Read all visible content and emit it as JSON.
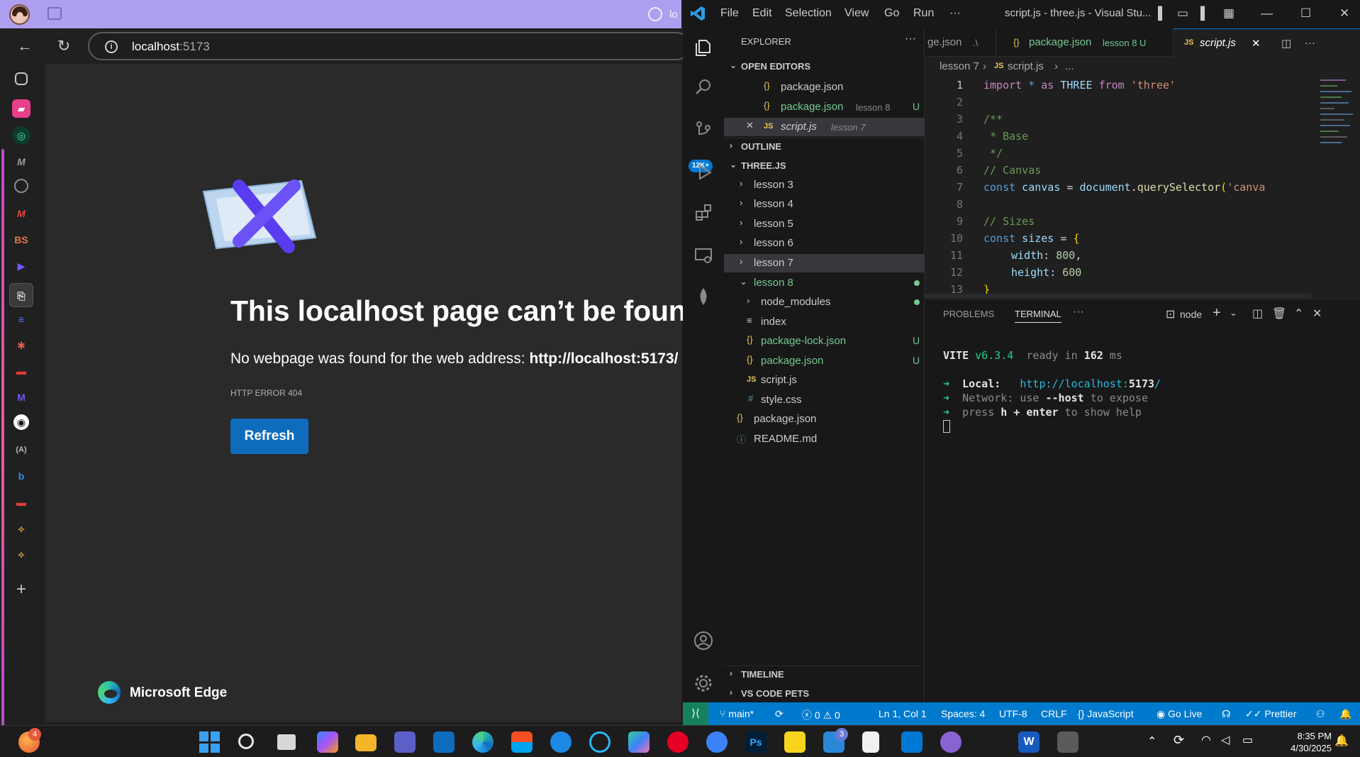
{
  "edge": {
    "tab_fragment": "lo",
    "address": {
      "host": "localhost",
      "port": ":5173"
    },
    "error": {
      "title": "This localhost page can’t be found",
      "subtitle_prefix": "No webpage was found for the web address: ",
      "subtitle_url": "http://localhost:5173/",
      "code": "HTTP ERROR 404",
      "refresh_label": "Refresh"
    },
    "brand": "Microsoft Edge"
  },
  "vscode": {
    "menus": [
      "File",
      "Edit",
      "Selection",
      "View",
      "Go",
      "Run",
      "···"
    ],
    "window_title": "script.js - three.js - Visual Stu...",
    "activity_badge": "12K+",
    "explorer": {
      "header": "EXPLORER",
      "open_editors": "OPEN EDITORS",
      "outline": "OUTLINE",
      "project": "THREE.JS",
      "timeline": "TIMELINE",
      "pets": "VS CODE PETS",
      "open_files": [
        {
          "name": "package.json",
          "desc": "",
          "status": ""
        },
        {
          "name": "package.json",
          "desc": "lesson 8",
          "status": "U"
        },
        {
          "name": "script.js",
          "desc": "lesson 7",
          "status": ""
        }
      ],
      "tree": [
        {
          "name": "lesson 3"
        },
        {
          "name": "lesson 4"
        },
        {
          "name": "lesson 5"
        },
        {
          "name": "lesson 6"
        },
        {
          "name": "lesson 7"
        },
        {
          "name": "lesson 8"
        },
        {
          "name": "node_modules"
        },
        {
          "name": "index"
        },
        {
          "name": "package-lock.json",
          "status": "U"
        },
        {
          "name": "package.json",
          "status": "U"
        },
        {
          "name": "script.js"
        },
        {
          "name": "style.css"
        },
        {
          "name": "package.json"
        },
        {
          "name": "README.md"
        }
      ]
    },
    "tabs": [
      {
        "name": "ge.json",
        "desc": ".\\"
      },
      {
        "name": "package.json",
        "desc": "lesson 8 U"
      },
      {
        "name": "script.js",
        "desc": ""
      }
    ],
    "breadcrumb": [
      "lesson 7",
      "script.js",
      "..."
    ],
    "code": {
      "line_numbers": [
        "1",
        "2",
        "3",
        "4",
        "5",
        "6",
        "7",
        "8",
        "9",
        "10",
        "11",
        "12",
        "13"
      ],
      "l1": {
        "kw": "import",
        "op": " * ",
        "as": "as",
        "ns": " THREE ",
        "from": "from",
        "str": " 'three'"
      },
      "l3": "/**",
      "l4": " * Base",
      "l5": " */",
      "l6": "// Canvas",
      "l7": {
        "kw": "const",
        "var": " canvas",
        "eq": " = ",
        "obj": "document",
        "dot": ".",
        "fn": "querySelector",
        "paren": "(",
        "str": "'canva"
      },
      "l9": "// Sizes",
      "l10": {
        "kw": "const",
        "var": " sizes",
        "eq": " = ",
        "br": "{"
      },
      "l11": {
        "key": "width",
        "val": "800",
        "p": ","
      },
      "l12": {
        "key": "height",
        "val": "600"
      },
      "l13": "}"
    },
    "panel": {
      "problems": "PROBLEMS",
      "terminal": "TERMINAL",
      "shell": "node",
      "vite": "VITE",
      "version": " v6.3.4",
      "ready": "  ready in ",
      "ms_value": "162",
      "ms": " ms",
      "local_label": "Local:",
      "local_url": "http://localhost:",
      "local_port": "5173",
      "local_slash": "/",
      "network_label": "Network:",
      "network_text": " use ",
      "network_flag": "--host",
      "network_tail": " to expose",
      "help_pre": "press ",
      "help_key": "h + enter",
      "help_tail": " to show help"
    },
    "status": {
      "branch": "main*",
      "errors": "0",
      "warnings": "0",
      "position": "Ln 1, Col 1",
      "spaces": "Spaces: 4",
      "encoding": "UTF-8",
      "eol": "CRLF",
      "language": "JavaScript",
      "golive": "Go Live",
      "prettier": "Prettier"
    }
  },
  "taskbar": {
    "time": "8:35 PM",
    "date": "4/30/2025",
    "firefox_badge": "4",
    "vs_badge": "3"
  }
}
